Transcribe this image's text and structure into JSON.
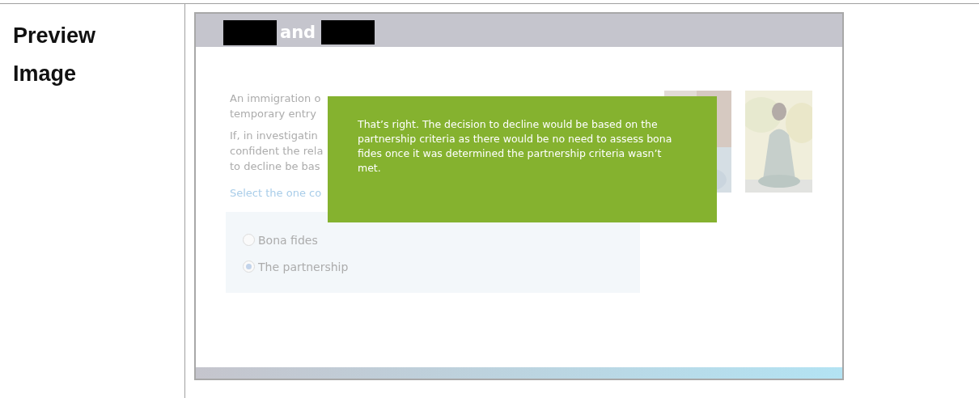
{
  "label": "Preview Image",
  "slide": {
    "header": [
      {
        "kind": "redacted"
      },
      {
        "kind": "text",
        "text": "and"
      },
      {
        "kind": "redacted"
      }
    ],
    "paragraphs": [
      [
        "An immigration o",
        "temporary entry"
      ],
      [
        "If, in investigatin",
        "confident the rela",
        "to decline be bas"
      ]
    ],
    "prompt": "Select the one co",
    "options": [
      {
        "label": "Bona fides",
        "selected": false
      },
      {
        "label": "The partnership",
        "selected": true
      }
    ],
    "pictures": [
      {
        "kind": "picture"
      },
      {
        "kind": "picture"
      }
    ],
    "feedback": "That’s right. The decision to decline would be based on the partnership criteria as there would be no need to assess bona fides once it was determined the partnership criteria wasn’t met."
  }
}
